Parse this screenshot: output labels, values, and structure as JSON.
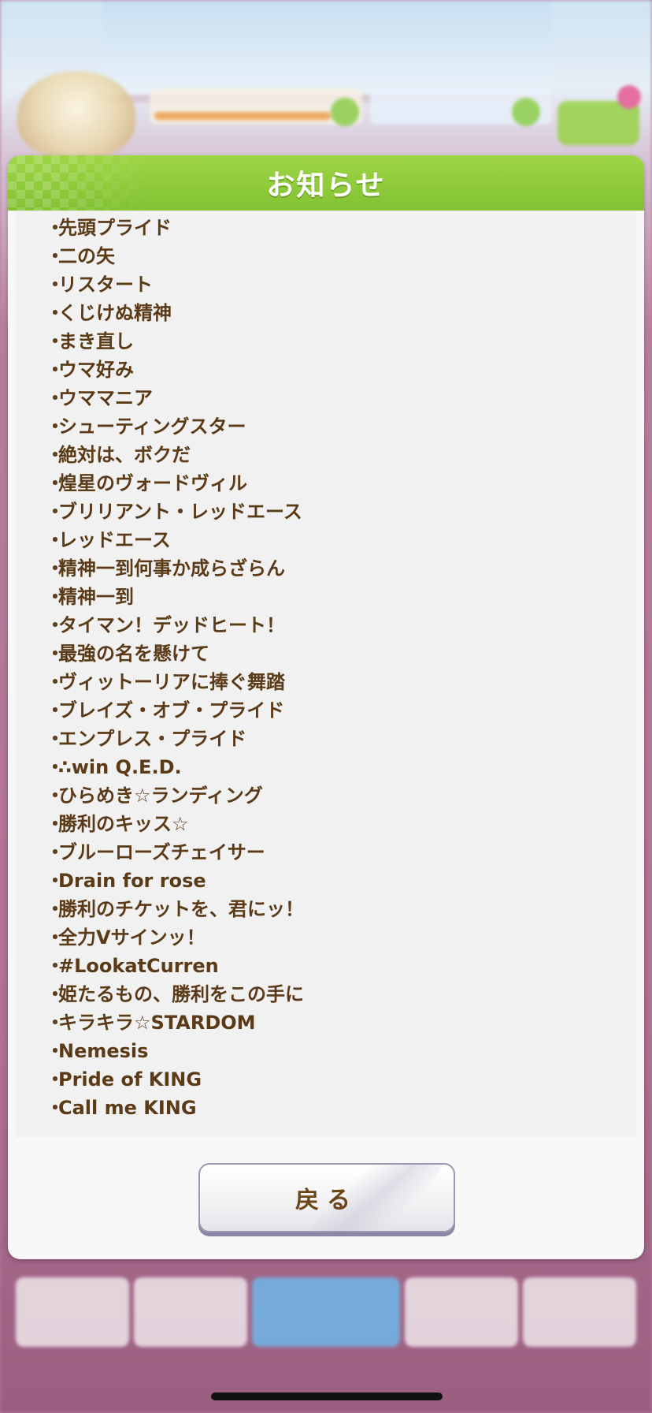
{
  "dialog": {
    "title": "お知らせ",
    "back_button_label": "戻る"
  },
  "skills": [
    "先頭プライド",
    "二の矢",
    "リスタート",
    "くじけぬ精神",
    "まき直し",
    "ウマ好み",
    "ウママニア",
    "シューティングスター",
    "絶対は、ボクだ",
    "煌星のヴォードヴィル",
    "ブリリアント・レッドエース",
    "レッドエース",
    "精神一到何事か成らざらん",
    "精神一到",
    "タイマン！デッドヒート！",
    "最強の名を懸けて",
    "ヴィットーリアに捧ぐ舞踏",
    "ブレイズ・オブ・プライド",
    "エンプレス・プライド",
    "∴win Q.E.D.",
    "ひらめき☆ランディング",
    "勝利のキッス☆",
    "ブルーローズチェイサー",
    "Drain for rose",
    "勝利のチケットを、君にッ！",
    "全力Vサインッ！",
    "#LookatCurren",
    "姫たるもの、勝利をこの手に",
    "キラキラ☆STARDOM",
    "Nemesis",
    "Pride of KING",
    "Call me KING"
  ],
  "bullet": "・",
  "colors": {
    "header_green": "#8cc83a",
    "text_brown": "#5b3a17",
    "panel_bg": "#f1f1f1"
  }
}
